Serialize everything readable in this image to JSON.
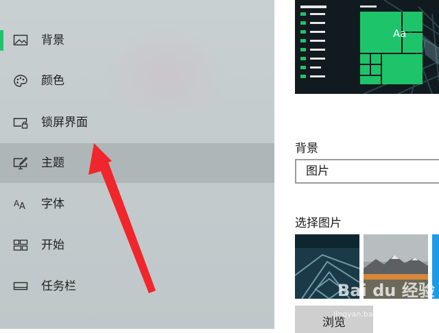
{
  "sidebar": {
    "items": [
      {
        "label": "背景",
        "icon": "picture-icon"
      },
      {
        "label": "颜色",
        "icon": "palette-icon"
      },
      {
        "label": "锁屏界面",
        "icon": "lock-screen-icon"
      },
      {
        "label": "主题",
        "icon": "theme-brush-icon"
      },
      {
        "label": "字体",
        "icon": "font-icon"
      },
      {
        "label": "开始",
        "icon": "start-grid-icon"
      },
      {
        "label": "任务栏",
        "icon": "taskbar-icon"
      }
    ],
    "active_index": 0,
    "highlighted_index": 3
  },
  "preview": {
    "tile_text": "Aa"
  },
  "background_section": {
    "title": "背景",
    "dropdown_value": "图片"
  },
  "choose_picture": {
    "title": "选择图片",
    "browse_label": "浏览"
  },
  "watermark": {
    "text": "Bai du 经验",
    "url": "jingyan.baidu.com"
  },
  "colors": {
    "accent": "#1ec46a",
    "arrow": "#f0262c"
  }
}
